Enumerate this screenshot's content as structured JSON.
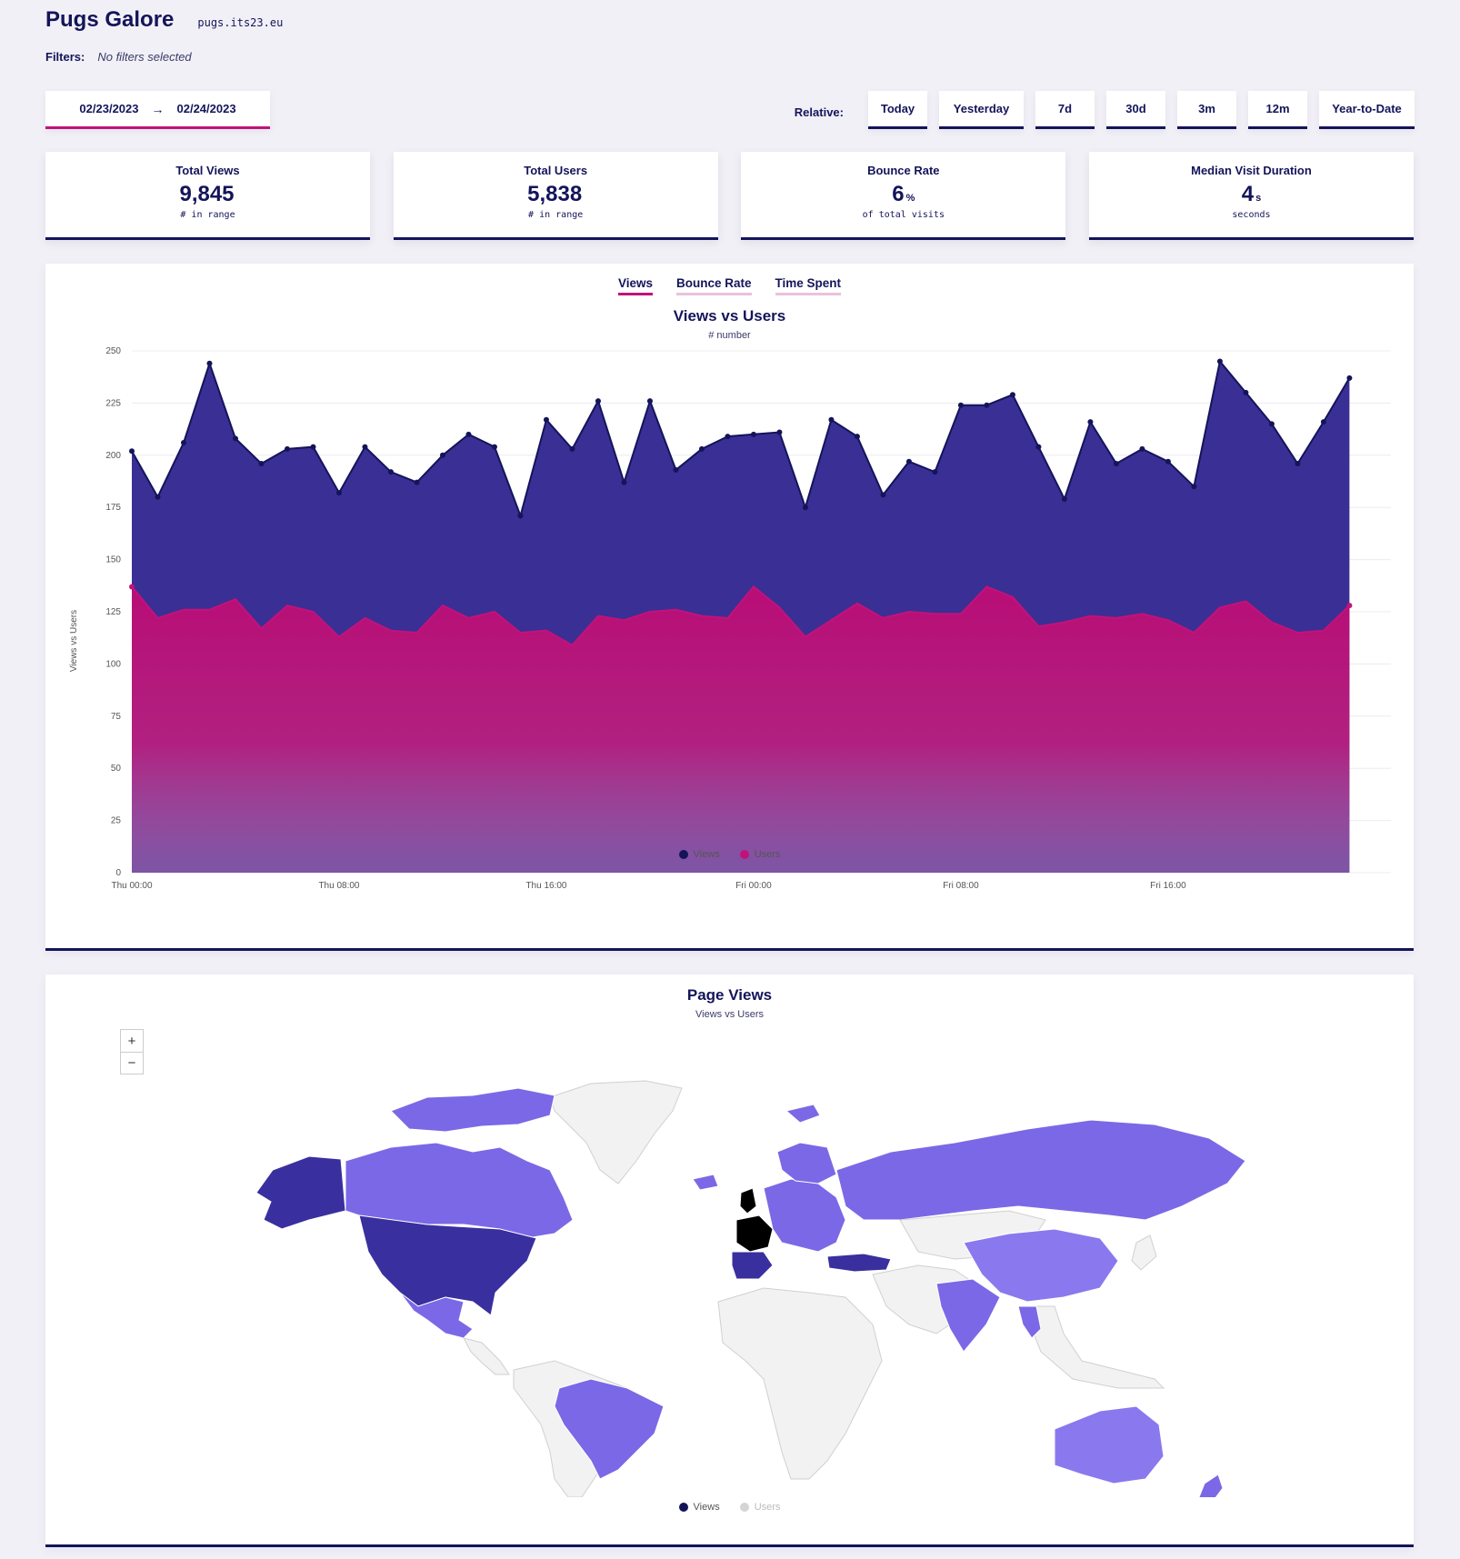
{
  "header": {
    "site_name": "Pugs Galore",
    "domain": "pugs.its23.eu"
  },
  "filters": {
    "label": "Filters:",
    "value": "No filters selected"
  },
  "date_range": {
    "start": "02/23/2023",
    "arrow": "→",
    "end": "02/24/2023"
  },
  "relative": {
    "label": "Relative:",
    "options": [
      "Today",
      "Yesterday",
      "7d",
      "30d",
      "3m",
      "12m",
      "Year-to-Date"
    ]
  },
  "stats": [
    {
      "title": "Total Views",
      "value": "9,845",
      "unit": "",
      "sub": "# in range"
    },
    {
      "title": "Total Users",
      "value": "5,838",
      "unit": "",
      "sub": "# in range"
    },
    {
      "title": "Bounce Rate",
      "value": "6",
      "unit": "%",
      "sub": "of total visits"
    },
    {
      "title": "Median Visit Duration",
      "value": "4",
      "unit": "s",
      "sub": "seconds"
    }
  ],
  "chart_tabs": [
    "Views",
    "Bounce Rate",
    "Time Spent"
  ],
  "colors": {
    "views": "#3a2f95",
    "views_line": "#14145a",
    "users": "#c2127a",
    "accent": "#c2127a",
    "navy": "#14145a"
  },
  "chart_data": {
    "type": "area",
    "title": "Views vs Users",
    "subtitle": "# number",
    "ylabel": "Views vs Users",
    "xlabel": "",
    "ylim": [
      0,
      250
    ],
    "yticks": [
      "0",
      "25",
      "50",
      "75",
      "100",
      "125",
      "150",
      "175",
      "200",
      "225",
      "250"
    ],
    "xticks": [
      {
        "label": "Thu 00:00",
        "hour": 0
      },
      {
        "label": "Thu 08:00",
        "hour": 8
      },
      {
        "label": "Thu 16:00",
        "hour": 16
      },
      {
        "label": "Fri 00:00",
        "hour": 24
      },
      {
        "label": "Fri 08:00",
        "hour": 32
      },
      {
        "label": "Fri 16:00",
        "hour": 40
      }
    ],
    "x_hours": [
      0,
      1,
      2,
      3,
      4,
      5,
      6,
      7,
      8,
      9,
      10,
      11,
      12,
      13,
      14,
      15,
      16,
      17,
      18,
      19,
      20,
      21,
      22,
      23,
      24,
      25,
      26,
      27,
      28,
      29,
      30,
      31,
      32,
      33,
      34,
      35,
      36,
      37,
      38,
      39,
      40,
      41,
      42,
      43,
      44,
      45,
      46,
      47
    ],
    "series": [
      {
        "name": "Views",
        "values": [
          202,
          180,
          206,
          244,
          208,
          196,
          203,
          204,
          182,
          204,
          192,
          187,
          200,
          210,
          204,
          171,
          217,
          203,
          226,
          187,
          226,
          193,
          203,
          209,
          210,
          211,
          175,
          217,
          209,
          181,
          197,
          192,
          224,
          224,
          229,
          204,
          179,
          216,
          196,
          203,
          197,
          185,
          245,
          230,
          215,
          196,
          216,
          237
        ]
      },
      {
        "name": "Users",
        "values": [
          137,
          122,
          126,
          126,
          131,
          117,
          128,
          125,
          113,
          122,
          116,
          115,
          128,
          122,
          125,
          115,
          116,
          109,
          123,
          121,
          125,
          126,
          123,
          122,
          137,
          127,
          113,
          121,
          129,
          122,
          125,
          124,
          124,
          137,
          132,
          118,
          120,
          123,
          122,
          124,
          121,
          115,
          127,
          130,
          120,
          115,
          116,
          128
        ]
      }
    ],
    "legend": [
      "Views",
      "Users"
    ]
  },
  "map": {
    "title": "Page Views",
    "subtitle": "Views vs Users",
    "zoom_in": "+",
    "zoom_out": "−",
    "legend": [
      "Views",
      "Users"
    ]
  }
}
